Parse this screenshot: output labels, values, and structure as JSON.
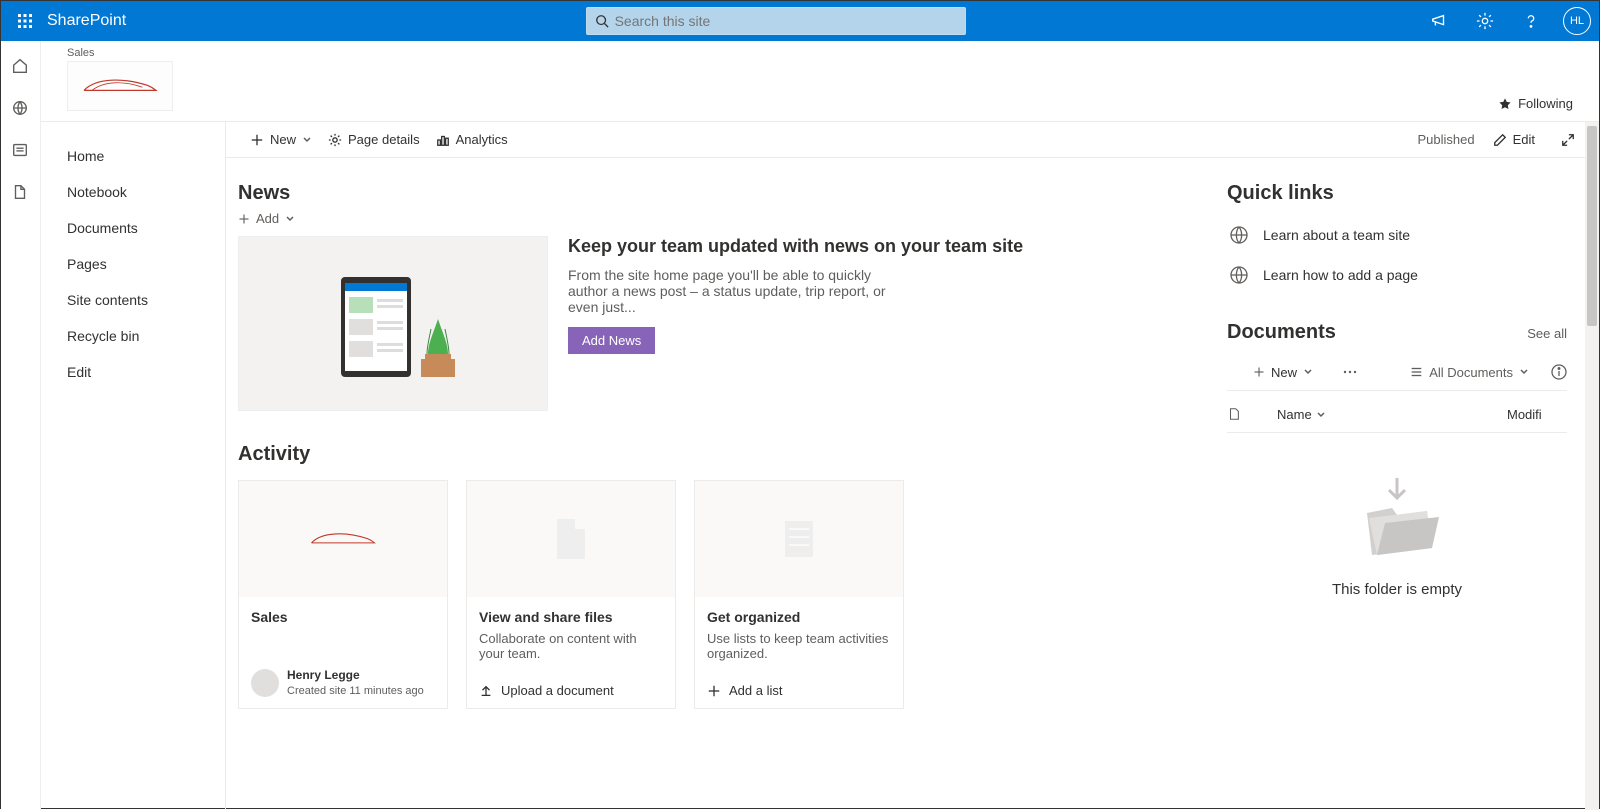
{
  "brand": "SharePoint",
  "search_placeholder": "Search this site",
  "avatar_initials": "HL",
  "site": {
    "link_label": "Sales"
  },
  "following_label": "Following",
  "left_nav": {
    "home": "Home",
    "notebook": "Notebook",
    "documents": "Documents",
    "pages": "Pages",
    "site_contents": "Site contents",
    "recycle_bin": "Recycle bin",
    "edit": "Edit"
  },
  "command_bar": {
    "new": "New",
    "page_details": "Page details",
    "analytics": "Analytics",
    "published": "Published",
    "edit": "Edit"
  },
  "news": {
    "heading": "News",
    "add": "Add",
    "title": "Keep your team updated with news on your team site",
    "desc": "From the site home page you'll be able to quickly author a news post – a status update, trip report, or even just...",
    "button": "Add News"
  },
  "activity": {
    "heading": "Activity",
    "cards": [
      {
        "title": "Sales",
        "person_name": "Henry Legge",
        "person_meta": "Created site 11 minutes ago"
      },
      {
        "title": "View and share files",
        "desc": "Collaborate on content with your team.",
        "action": "Upload a document"
      },
      {
        "title": "Get organized",
        "desc": "Use lists to keep team activities organized.",
        "action": "Add a list"
      }
    ]
  },
  "quick_links": {
    "heading": "Quick links",
    "items": [
      "Learn about a team site",
      "Learn how to add a page"
    ]
  },
  "documents": {
    "heading": "Documents",
    "see_all": "See all",
    "new": "New",
    "view_label": "All Documents",
    "col_name": "Name",
    "col_modified": "Modifi",
    "empty": "This folder is empty"
  }
}
